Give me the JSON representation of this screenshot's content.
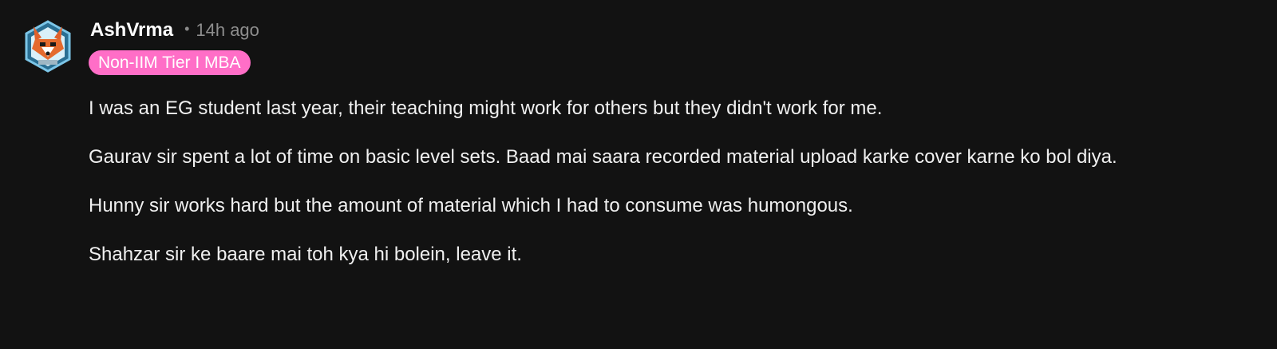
{
  "comment": {
    "author": "AshVrma",
    "separator": "•",
    "timestamp": "14h ago",
    "flair": "Non-IIM Tier I MBA",
    "paragraphs": [
      "I was an EG student last year, their teaching might work for others but they didn't work for me.",
      "Gaurav sir spent a lot of time on basic level sets. Baad mai saara recorded material upload karke cover karne ko bol diya.",
      "Hunny sir works hard but the amount of material which I had to consume was humongous.",
      "Shahzar sir ke baare mai toh kya hi bolein, leave it."
    ]
  },
  "colors": {
    "background": "#121212",
    "flair_background": "#ff6ec7",
    "text": "#f0f0f0",
    "muted": "#8e8e8e"
  },
  "icons": {
    "avatar": "fox-avatar-icon"
  }
}
